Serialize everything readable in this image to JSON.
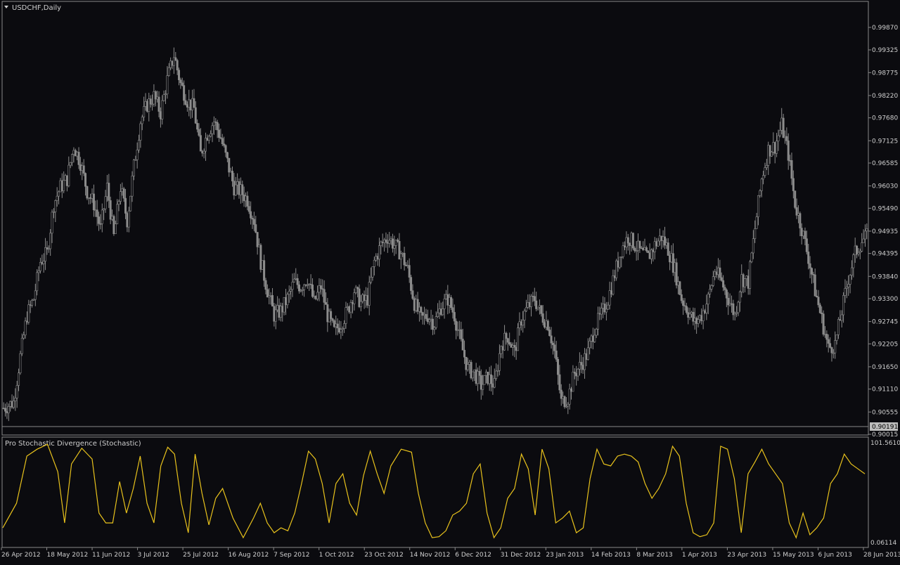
{
  "window": {
    "title": "USDCHF,Daily",
    "indicator_title": "Pro Stochastic Divergence (Stochastic)"
  },
  "colors": {
    "background": "#0b0b0f",
    "frame": "#8a8a8a",
    "candle": "#8c8c8c",
    "stochastic": "#e8c21c",
    "text": "#cfcfcf",
    "price_box": "#bdbdbd"
  },
  "chart_data": [
    {
      "type": "candlestick",
      "title": "USDCHF,Daily",
      "ylim": [
        0.90015,
        1.00142
      ],
      "y_ticks": [
        "0.99870",
        "0.99325",
        "0.98775",
        "0.98220",
        "0.97680",
        "0.97125",
        "0.96585",
        "0.96030",
        "0.95490",
        "0.94935",
        "0.94395",
        "0.93840",
        "0.93300",
        "0.92745",
        "0.92205",
        "0.91650",
        "0.91110",
        "0.90555",
        "0.90015"
      ],
      "current_price": "0.90191",
      "x_ticks": [
        "26 Apr 2012",
        "18 May 2012",
        "11 Jun 2012",
        "3 Jul 2012",
        "25 Jul 2012",
        "16 Aug 2012",
        "7 Sep 2012",
        "1 Oct 2012",
        "23 Oct 2012",
        "14 Nov 2012",
        "6 Dec 2012",
        "31 Dec 2012",
        "23 Jan 2013",
        "14 Feb 2013",
        "8 Mar 2013",
        "1 Apr 2013",
        "23 Apr 2013",
        "15 May 2013",
        "6 Jun 2013",
        "28 Jun 2013"
      ],
      "close_anchors": [
        [
          0,
          0.9065
        ],
        [
          6,
          0.908
        ],
        [
          10,
          0.919
        ],
        [
          14,
          0.929
        ],
        [
          18,
          0.933
        ],
        [
          22,
          0.942
        ],
        [
          26,
          0.944
        ],
        [
          30,
          0.956
        ],
        [
          34,
          0.96
        ],
        [
          38,
          0.962
        ],
        [
          42,
          0.97
        ],
        [
          46,
          0.966
        ],
        [
          50,
          0.959
        ],
        [
          54,
          0.956
        ],
        [
          58,
          0.95
        ],
        [
          62,
          0.96
        ],
        [
          66,
          0.948
        ],
        [
          70,
          0.96
        ],
        [
          74,
          0.952
        ],
        [
          78,
          0.965
        ],
        [
          82,
          0.976
        ],
        [
          86,
          0.98
        ],
        [
          90,
          0.982
        ],
        [
          94,
          0.978
        ],
        [
          98,
          0.986
        ],
        [
          102,
          0.992
        ],
        [
          106,
          0.985
        ],
        [
          110,
          0.981
        ],
        [
          114,
          0.979
        ],
        [
          118,
          0.968
        ],
        [
          122,
          0.973
        ],
        [
          126,
          0.976
        ],
        [
          130,
          0.972
        ],
        [
          134,
          0.966
        ],
        [
          138,
          0.96
        ],
        [
          142,
          0.959
        ],
        [
          146,
          0.957
        ],
        [
          150,
          0.952
        ],
        [
          154,
          0.942
        ],
        [
          158,
          0.935
        ],
        [
          162,
          0.929
        ],
        [
          166,
          0.93
        ],
        [
          170,
          0.933
        ],
        [
          174,
          0.937
        ],
        [
          178,
          0.936
        ],
        [
          182,
          0.938
        ],
        [
          186,
          0.932
        ],
        [
          190,
          0.936
        ],
        [
          194,
          0.929
        ],
        [
          198,
          0.925
        ],
        [
          202,
          0.927
        ],
        [
          206,
          0.93
        ],
        [
          210,
          0.935
        ],
        [
          214,
          0.932
        ],
        [
          218,
          0.933
        ],
        [
          222,
          0.942
        ],
        [
          226,
          0.946
        ],
        [
          230,
          0.948
        ],
        [
          234,
          0.946
        ],
        [
          238,
          0.944
        ],
        [
          242,
          0.94
        ],
        [
          246,
          0.932
        ],
        [
          250,
          0.928
        ],
        [
          254,
          0.929
        ],
        [
          258,
          0.927
        ],
        [
          262,
          0.931
        ],
        [
          266,
          0.933
        ],
        [
          270,
          0.929
        ],
        [
          274,
          0.922
        ],
        [
          278,
          0.916
        ],
        [
          282,
          0.915
        ],
        [
          286,
          0.912
        ],
        [
          290,
          0.914
        ],
        [
          294,
          0.912
        ],
        [
          298,
          0.922
        ],
        [
          302,
          0.924
        ],
        [
          306,
          0.92
        ],
        [
          310,
          0.928
        ],
        [
          314,
          0.931
        ],
        [
          318,
          0.933
        ],
        [
          322,
          0.929
        ],
        [
          326,
          0.927
        ],
        [
          330,
          0.92
        ],
        [
          334,
          0.908
        ],
        [
          338,
          0.909
        ],
        [
          342,
          0.915
        ],
        [
          346,
          0.917
        ],
        [
          350,
          0.92
        ],
        [
          354,
          0.926
        ],
        [
          358,
          0.929
        ],
        [
          362,
          0.933
        ],
        [
          366,
          0.939
        ],
        [
          370,
          0.945
        ],
        [
          374,
          0.948
        ],
        [
          378,
          0.946
        ],
        [
          382,
          0.944
        ],
        [
          386,
          0.943
        ],
        [
          390,
          0.946
        ],
        [
          394,
          0.948
        ],
        [
          398,
          0.945
        ],
        [
          402,
          0.94
        ],
        [
          406,
          0.933
        ],
        [
          410,
          0.93
        ],
        [
          414,
          0.927
        ],
        [
          418,
          0.929
        ],
        [
          422,
          0.933
        ],
        [
          426,
          0.94
        ],
        [
          430,
          0.937
        ],
        [
          434,
          0.933
        ],
        [
          438,
          0.929
        ],
        [
          442,
          0.938
        ],
        [
          446,
          0.937
        ],
        [
          450,
          0.95
        ],
        [
          454,
          0.962
        ],
        [
          458,
          0.969
        ],
        [
          462,
          0.97
        ],
        [
          466,
          0.975
        ],
        [
          470,
          0.968
        ],
        [
          474,
          0.956
        ],
        [
          478,
          0.95
        ],
        [
          482,
          0.943
        ],
        [
          486,
          0.935
        ],
        [
          490,
          0.928
        ],
        [
          494,
          0.921
        ],
        [
          498,
          0.922
        ],
        [
          502,
          0.93
        ],
        [
          506,
          0.938
        ],
        [
          510,
          0.944
        ],
        [
          514,
          0.947
        ],
        [
          517,
          0.948
        ]
      ]
    },
    {
      "type": "line",
      "title": "Pro Stochastic Divergence (Stochastic)",
      "ylim": [
        0.06114,
        101.56105
      ],
      "y_ticks": [
        "101.56105",
        "0.06114"
      ],
      "series": [
        {
          "values": [
            [
              0,
              15
            ],
            [
              8,
              40
            ],
            [
              14,
              88
            ],
            [
              20,
              95
            ],
            [
              26,
              100
            ],
            [
              32,
              72
            ],
            [
              36,
              20
            ],
            [
              40,
              80
            ],
            [
              46,
              96
            ],
            [
              52,
              85
            ],
            [
              56,
              30
            ],
            [
              60,
              20
            ],
            [
              64,
              20
            ],
            [
              68,
              62
            ],
            [
              72,
              30
            ],
            [
              76,
              55
            ],
            [
              80,
              88
            ],
            [
              84,
              40
            ],
            [
              88,
              20
            ],
            [
              92,
              78
            ],
            [
              96,
              97
            ],
            [
              100,
              90
            ],
            [
              104,
              40
            ],
            [
              108,
              10
            ],
            [
              112,
              90
            ],
            [
              116,
              50
            ],
            [
              120,
              18
            ],
            [
              124,
              45
            ],
            [
              128,
              55
            ],
            [
              134,
              25
            ],
            [
              140,
              5
            ],
            [
              146,
              25
            ],
            [
              150,
              40
            ],
            [
              154,
              20
            ],
            [
              158,
              10
            ],
            [
              162,
              15
            ],
            [
              166,
              12
            ],
            [
              170,
              30
            ],
            [
              174,
              60
            ],
            [
              178,
              93
            ],
            [
              182,
              85
            ],
            [
              186,
              60
            ],
            [
              190,
              20
            ],
            [
              194,
              60
            ],
            [
              198,
              70
            ],
            [
              202,
              40
            ],
            [
              206,
              28
            ],
            [
              210,
              68
            ],
            [
              214,
              93
            ],
            [
              218,
              70
            ],
            [
              222,
              50
            ],
            [
              226,
              78
            ],
            [
              232,
              95
            ],
            [
              238,
              92
            ],
            [
              242,
              50
            ],
            [
              246,
              20
            ],
            [
              250,
              5
            ],
            [
              254,
              6
            ],
            [
              258,
              12
            ],
            [
              262,
              28
            ],
            [
              266,
              32
            ],
            [
              270,
              40
            ],
            [
              274,
              70
            ],
            [
              278,
              80
            ],
            [
              282,
              30
            ],
            [
              286,
              5
            ],
            [
              290,
              15
            ],
            [
              294,
              45
            ],
            [
              298,
              55
            ],
            [
              302,
              90
            ],
            [
              306,
              75
            ],
            [
              310,
              28
            ],
            [
              314,
              95
            ],
            [
              318,
              75
            ],
            [
              322,
              20
            ],
            [
              326,
              25
            ],
            [
              330,
              32
            ],
            [
              334,
              10
            ],
            [
              338,
              15
            ],
            [
              342,
              65
            ],
            [
              346,
              95
            ],
            [
              350,
              80
            ],
            [
              354,
              78
            ],
            [
              358,
              88
            ],
            [
              362,
              90
            ],
            [
              366,
              88
            ],
            [
              370,
              82
            ],
            [
              374,
              60
            ],
            [
              378,
              45
            ],
            [
              382,
              55
            ],
            [
              386,
              70
            ],
            [
              390,
              98
            ],
            [
              394,
              88
            ],
            [
              398,
              40
            ],
            [
              402,
              10
            ],
            [
              406,
              6
            ],
            [
              410,
              8
            ],
            [
              414,
              20
            ],
            [
              418,
              98
            ],
            [
              422,
              95
            ],
            [
              426,
              65
            ],
            [
              430,
              10
            ],
            [
              434,
              70
            ],
            [
              438,
              82
            ],
            [
              442,
              95
            ],
            [
              446,
              80
            ],
            [
              450,
              70
            ],
            [
              454,
              60
            ],
            [
              458,
              20
            ],
            [
              462,
              5
            ],
            [
              466,
              30
            ],
            [
              470,
              8
            ],
            [
              474,
              15
            ],
            [
              478,
              25
            ],
            [
              482,
              60
            ],
            [
              486,
              70
            ],
            [
              490,
              90
            ],
            [
              494,
              80
            ],
            [
              498,
              75
            ],
            [
              502,
              70
            ]
          ]
        }
      ]
    }
  ]
}
